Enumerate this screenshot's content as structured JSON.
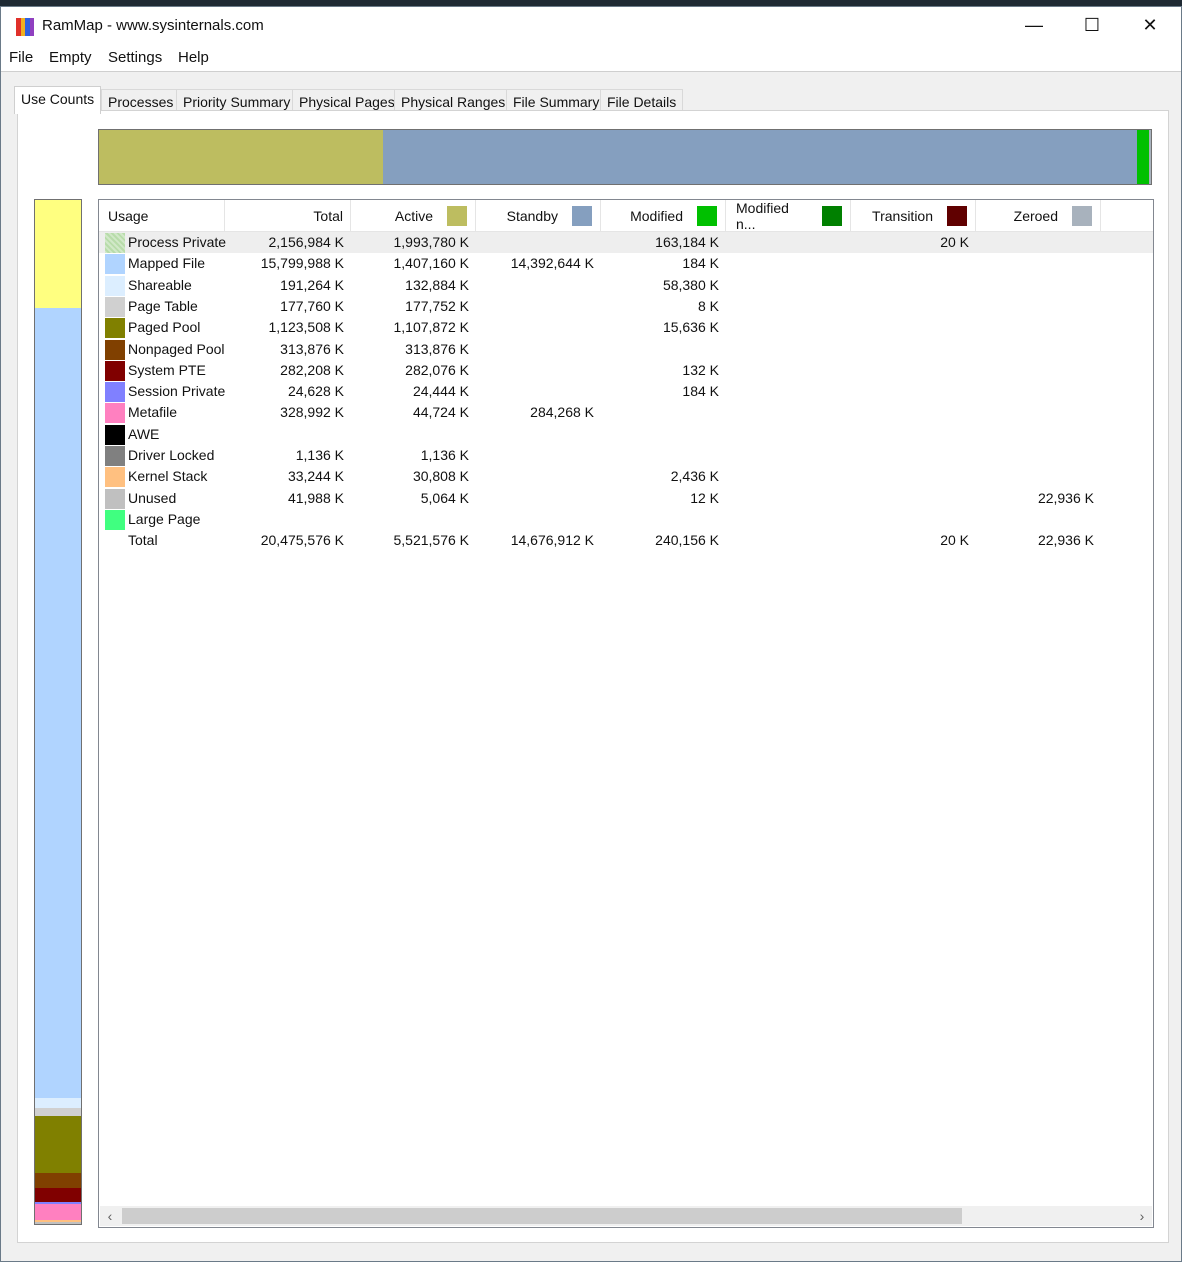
{
  "window": {
    "title": "RamMap - www.sysinternals.com",
    "icon_name": "rammap-app-icon",
    "controls": {
      "minimize": "—",
      "maximize": "☐",
      "close": "✕"
    }
  },
  "menu": [
    "File",
    "Empty",
    "Settings",
    "Help"
  ],
  "tabs": [
    "Use Counts",
    "Processes",
    "Priority Summary",
    "Physical Pages",
    "Physical Ranges",
    "File Summary",
    "File Details"
  ],
  "active_tab": "Use Counts",
  "columns": [
    {
      "label": "Usage",
      "color": null
    },
    {
      "label": "Total",
      "color": null
    },
    {
      "label": "Active",
      "color": "#bdbd60"
    },
    {
      "label": "Standby",
      "color": "#859fbf"
    },
    {
      "label": "Modified",
      "color": "#00c000"
    },
    {
      "label": "Modified n...",
      "color": "#008000"
    },
    {
      "label": "Transition",
      "color": "#600000"
    },
    {
      "label": "Zeroed",
      "color": "#a8b2bd"
    }
  ],
  "rows": [
    {
      "usage": "Process Private",
      "color": "#b8dcaa",
      "total": "2,156,984 K",
      "active": "1,993,780 K",
      "standby": "",
      "modified": "163,184 K",
      "modified_no_write": "",
      "transition": "20 K",
      "zeroed": ""
    },
    {
      "usage": "Mapped File",
      "color": "#b0d4ff",
      "total": "15,799,988 K",
      "active": "1,407,160 K",
      "standby": "14,392,644 K",
      "modified": "184 K",
      "modified_no_write": "",
      "transition": "",
      "zeroed": ""
    },
    {
      "usage": "Shareable",
      "color": "#dceeff",
      "total": "191,264 K",
      "active": "132,884 K",
      "standby": "",
      "modified": "58,380 K",
      "modified_no_write": "",
      "transition": "",
      "zeroed": ""
    },
    {
      "usage": "Page Table",
      "color": "#d0d0d0",
      "total": "177,760 K",
      "active": "177,752 K",
      "standby": "",
      "modified": "8 K",
      "modified_no_write": "",
      "transition": "",
      "zeroed": ""
    },
    {
      "usage": "Paged Pool",
      "color": "#808000",
      "total": "1,123,508 K",
      "active": "1,107,872 K",
      "standby": "",
      "modified": "15,636 K",
      "modified_no_write": "",
      "transition": "",
      "zeroed": ""
    },
    {
      "usage": "Nonpaged Pool",
      "color": "#804000",
      "total": "313,876 K",
      "active": "313,876 K",
      "standby": "",
      "modified": "",
      "modified_no_write": "",
      "transition": "",
      "zeroed": ""
    },
    {
      "usage": "System PTE",
      "color": "#800000",
      "total": "282,208 K",
      "active": "282,076 K",
      "standby": "",
      "modified": "132 K",
      "modified_no_write": "",
      "transition": "",
      "zeroed": ""
    },
    {
      "usage": "Session Private",
      "color": "#8080ff",
      "total": "24,628 K",
      "active": "24,444 K",
      "standby": "",
      "modified": "184 K",
      "modified_no_write": "",
      "transition": "",
      "zeroed": ""
    },
    {
      "usage": "Metafile",
      "color": "#ff80c0",
      "total": "328,992 K",
      "active": "44,724 K",
      "standby": "284,268 K",
      "modified": "",
      "modified_no_write": "",
      "transition": "",
      "zeroed": ""
    },
    {
      "usage": "AWE",
      "color": "#000000",
      "total": "",
      "active": "",
      "standby": "",
      "modified": "",
      "modified_no_write": "",
      "transition": "",
      "zeroed": ""
    },
    {
      "usage": "Driver Locked",
      "color": "#808080",
      "total": "1,136 K",
      "active": "1,136 K",
      "standby": "",
      "modified": "",
      "modified_no_write": "",
      "transition": "",
      "zeroed": ""
    },
    {
      "usage": "Kernel Stack",
      "color": "#ffc080",
      "total": "33,244 K",
      "active": "30,808 K",
      "standby": "",
      "modified": "2,436 K",
      "modified_no_write": "",
      "transition": "",
      "zeroed": ""
    },
    {
      "usage": "Unused",
      "color": "#c0c0c0",
      "total": "41,988 K",
      "active": "5,064 K",
      "standby": "",
      "modified": "12 K",
      "modified_no_write": "",
      "transition": "",
      "zeroed": "22,936 K"
    },
    {
      "usage": "Large Page",
      "color": "#40ff80",
      "total": "",
      "active": "",
      "standby": "",
      "modified": "",
      "modified_no_write": "",
      "transition": "",
      "zeroed": ""
    },
    {
      "usage": "Total",
      "color": null,
      "total": "20,475,576 K",
      "active": "5,521,576 K",
      "standby": "14,676,912 K",
      "modified": "240,156 K",
      "modified_no_write": "",
      "transition": "20 K",
      "zeroed": "22,936 K"
    }
  ],
  "state_bar": [
    {
      "state": "Active",
      "color": "#bdbd60",
      "kb": 5521576
    },
    {
      "state": "Standby",
      "color": "#859fbf",
      "kb": 14676912
    },
    {
      "state": "Modified",
      "color": "#00c000",
      "kb": 240156
    },
    {
      "state": "Transition",
      "color": "#600000",
      "kb": 20
    },
    {
      "state": "Zeroed",
      "color": "#a8b2bd",
      "kb": 22936
    }
  ],
  "usage_bar": [
    {
      "usage": "Process Private",
      "color": "#ffff80",
      "kb": 2156984
    },
    {
      "usage": "Mapped File",
      "color": "#b0d4ff",
      "kb": 15799988
    },
    {
      "usage": "Shareable",
      "color": "#dceeff",
      "kb": 191264
    },
    {
      "usage": "Page Table",
      "color": "#d0d0d0",
      "kb": 177760
    },
    {
      "usage": "Paged Pool",
      "color": "#808000",
      "kb": 1123508
    },
    {
      "usage": "Nonpaged Pool",
      "color": "#804000",
      "kb": 313876
    },
    {
      "usage": "System PTE",
      "color": "#800000",
      "kb": 282208
    },
    {
      "usage": "Session Private",
      "color": "#8080ff",
      "kb": 24628
    },
    {
      "usage": "Metafile",
      "color": "#ff80c0",
      "kb": 328992
    },
    {
      "usage": "Driver Locked",
      "color": "#808080",
      "kb": 1136
    },
    {
      "usage": "Kernel Stack",
      "color": "#ffc080",
      "kb": 33244
    },
    {
      "usage": "Unused",
      "color": "#c0c0c0",
      "kb": 41988
    }
  ],
  "scrollbar": {
    "left_arrow": "‹",
    "right_arrow": "›",
    "thumb_fraction": 0.83
  }
}
